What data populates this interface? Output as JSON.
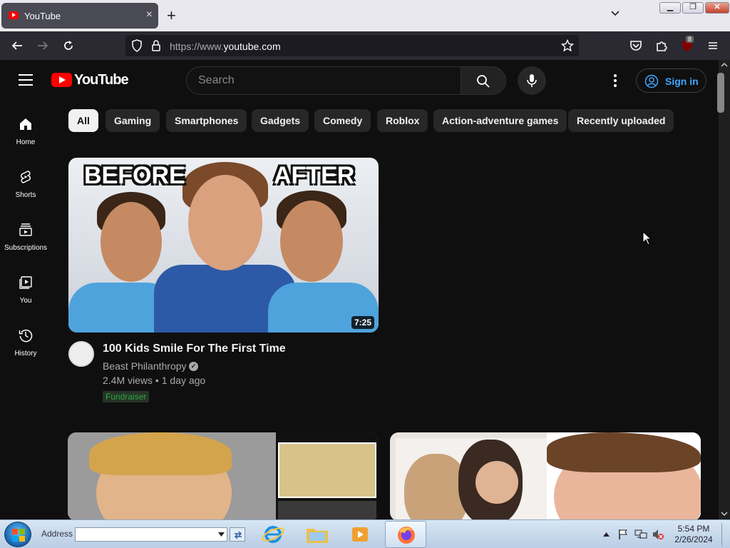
{
  "browser": {
    "tab_title": "YouTube",
    "url_prefix": "https://www.",
    "url_domain": "youtube.com",
    "extension_badge": "8"
  },
  "youtube": {
    "logo_text": "YouTube",
    "search_placeholder": "Search",
    "sign_in": "Sign in"
  },
  "sidebar": {
    "items": [
      {
        "label": "Home"
      },
      {
        "label": "Shorts"
      },
      {
        "label": "Subscriptions"
      },
      {
        "label": "You"
      },
      {
        "label": "History"
      }
    ]
  },
  "chips": [
    "All",
    "Gaming",
    "Smartphones",
    "Gadgets",
    "Comedy",
    "Roblox",
    "Action-adventure games",
    "Recently uploaded"
  ],
  "video1": {
    "thumb_before": "BEFORE",
    "thumb_after": "AFTER",
    "duration": "7:25",
    "title": "100 Kids Smile For The First Time",
    "channel": "Beast Philanthropy",
    "meta": "2.4M views • 1 day ago",
    "badge": "Fundraiser"
  },
  "taskbar": {
    "address_label": "Address",
    "time": "5:54 PM",
    "date": "2/26/2024"
  }
}
